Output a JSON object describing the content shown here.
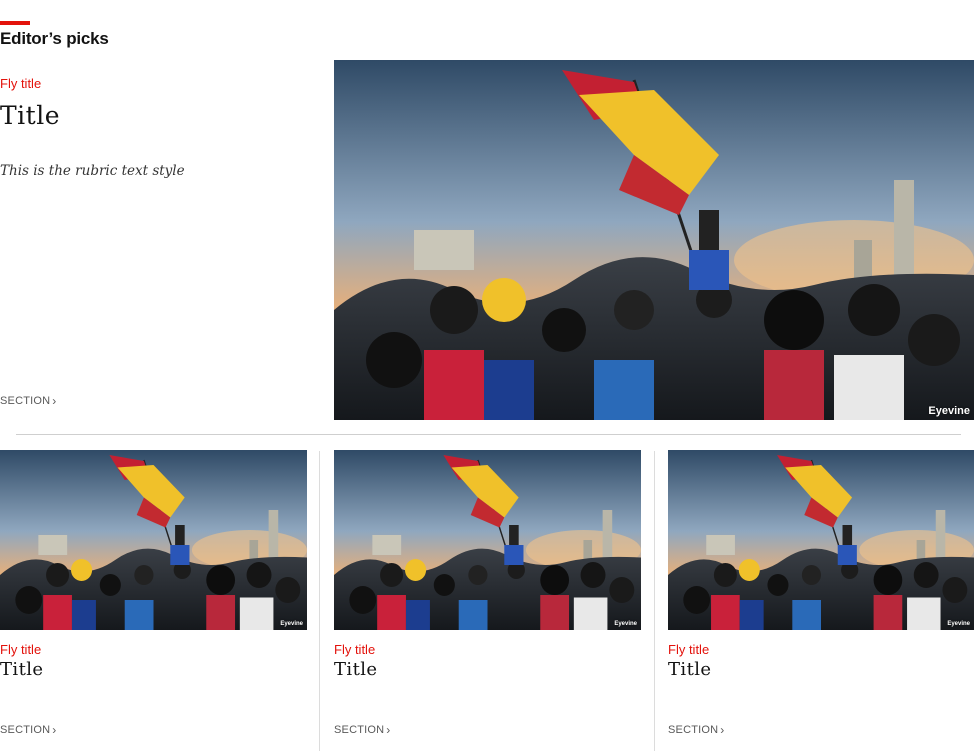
{
  "section": {
    "heading": "Editor’s picks"
  },
  "featured": {
    "fly_title": "Fly title",
    "title": "Title",
    "rubric": "This is the rubric text style",
    "section_label": "SECTION",
    "image_credit": "Eyevine"
  },
  "cards": [
    {
      "fly_title": "Fly title",
      "title": "Title",
      "section_label": "SECTION",
      "image_credit": "Eyevine"
    },
    {
      "fly_title": "Fly title",
      "title": "Title",
      "section_label": "SECTION",
      "image_credit": "Eyevine"
    },
    {
      "fly_title": "Fly title",
      "title": "Title",
      "section_label": "SECTION",
      "image_credit": "Eyevine"
    }
  ],
  "colors": {
    "accent": "#e3120b",
    "text": "#121212",
    "muted": "#595959"
  },
  "icons": {
    "section_link": "chevron-right-icon"
  }
}
